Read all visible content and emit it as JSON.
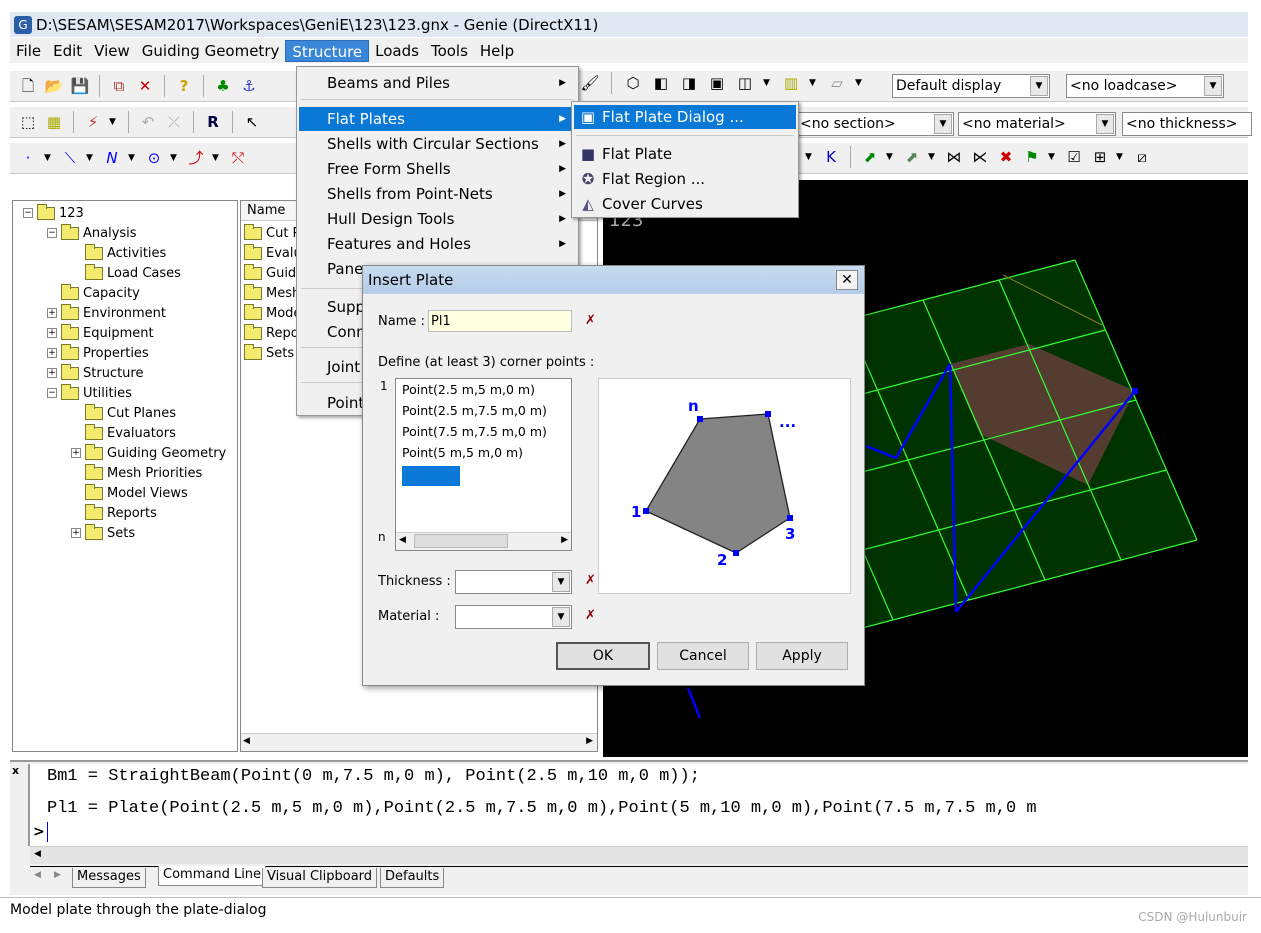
{
  "window": {
    "title": "D:\\SESAM\\SESAM2017\\Workspaces\\GeniE\\123\\123.gnx - Genie (DirectX11)",
    "icon": "genie-app-icon"
  },
  "menubar": [
    "File",
    "Edit",
    "View",
    "Guiding Geometry",
    "Structure",
    "Loads",
    "Tools",
    "Help"
  ],
  "toolbar": {
    "display_combo": "Default display",
    "loadcase_combo": "<no loadcase>",
    "section_combo": "<no section>",
    "material_combo": "<no material>",
    "thickness_combo": "<no thickness>"
  },
  "tree": {
    "root": "123",
    "items": [
      {
        "label": "Analysis",
        "level": 1,
        "expander": "-"
      },
      {
        "label": "Activities",
        "level": 2,
        "expander": ""
      },
      {
        "label": "Load Cases",
        "level": 2,
        "expander": ""
      },
      {
        "label": "Capacity",
        "level": 1,
        "expander": ""
      },
      {
        "label": "Environment",
        "level": 1,
        "expander": "+"
      },
      {
        "label": "Equipment",
        "level": 1,
        "expander": "+"
      },
      {
        "label": "Properties",
        "level": 1,
        "expander": "+"
      },
      {
        "label": "Structure",
        "level": 1,
        "expander": "+"
      },
      {
        "label": "Utilities",
        "level": 1,
        "expander": "-"
      },
      {
        "label": "Cut Planes",
        "level": 2,
        "expander": ""
      },
      {
        "label": "Evaluators",
        "level": 2,
        "expander": ""
      },
      {
        "label": "Guiding Geometry",
        "level": 2,
        "expander": "+"
      },
      {
        "label": "Mesh Priorities",
        "level": 2,
        "expander": ""
      },
      {
        "label": "Model Views",
        "level": 2,
        "expander": ""
      },
      {
        "label": "Reports",
        "level": 2,
        "expander": ""
      },
      {
        "label": "Sets",
        "level": 2,
        "expander": "+"
      }
    ]
  },
  "list": {
    "header": "Name",
    "items": [
      "Cut P",
      "Evalu",
      "Guidi",
      "Mesh",
      "Mode",
      "Repo",
      "Sets"
    ]
  },
  "structure_menu": {
    "items": [
      {
        "label": "Beams and Piles",
        "submenu": true
      },
      {
        "label": "Flat Plates",
        "submenu": true,
        "highlighted": true
      },
      {
        "label": "Shells with Circular Sections",
        "submenu": true
      },
      {
        "label": "Free Form Shells",
        "submenu": true
      },
      {
        "label": "Shells from Point-Nets",
        "submenu": true
      },
      {
        "label": "Hull Design Tools",
        "submenu": true
      },
      {
        "label": "Features and Holes",
        "submenu": true
      },
      {
        "label": "Pane",
        "submenu": true
      },
      {
        "label": "Supp"
      },
      {
        "label": "Conn"
      },
      {
        "label": "Joint"
      },
      {
        "label": "Point"
      }
    ]
  },
  "flat_plates_submenu": {
    "items": [
      {
        "label": "Flat Plate Dialog ...",
        "icon": "plate-dialog-icon",
        "highlighted": true
      },
      {
        "label": "Flat Plate",
        "icon": "flat-plate-icon"
      },
      {
        "label": "Flat Region ...",
        "icon": "flat-region-icon"
      },
      {
        "label": "Cover Curves",
        "icon": "cover-curves-icon"
      }
    ]
  },
  "viewport": {
    "label": "123"
  },
  "dialog": {
    "title": "Insert Plate",
    "name_label": "Name :",
    "name_value": "Pl1",
    "define_label": "Define (at least 3) corner points :",
    "first_index": "1",
    "last_index": "n",
    "points": [
      "Point(2.5 m,5 m,0 m)",
      "Point(2.5 m,7.5 m,0 m)",
      "Point(7.5 m,7.5 m,0 m)",
      "Point(5 m,5 m,0 m)"
    ],
    "preview_labels": [
      "1",
      "2",
      "3",
      "...",
      "n"
    ],
    "thickness_label": "Thickness :",
    "thickness_value": "",
    "material_label": "Material :",
    "material_value": "",
    "ok": "OK",
    "cancel": "Cancel",
    "apply": "Apply"
  },
  "command": {
    "lines": [
      "Bm1 = StraightBeam(Point(0 m,7.5 m,0 m), Point(2.5 m,10 m,0 m));",
      "Pl1 = Plate(Point(2.5 m,5 m,0 m),Point(2.5 m,7.5 m,0 m),Point(5 m,10 m,0 m),Point(7.5 m,7.5 m,0 m"
    ],
    "prompt": ">",
    "close": "x"
  },
  "bottom_tabs": [
    "Messages",
    "Command Line",
    "Visual Clipboard",
    "Defaults"
  ],
  "active_bottom_tab": "Command Line",
  "status": "Model plate through the plate-dialog",
  "watermark": "CSDN @Hulunbuir",
  "colors": {
    "highlight": "#0a78d7",
    "viewport_bg": "#000000",
    "grid_line": "#33ff33",
    "grid_fill": "#003300",
    "beam": "#0000ff",
    "plate": "#5a3d33"
  }
}
